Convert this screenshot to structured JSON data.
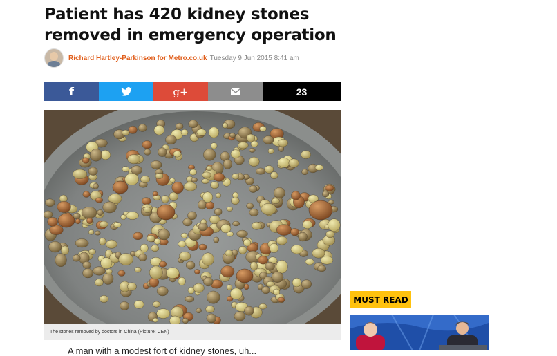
{
  "article": {
    "title": "Patient has 420 kidney stones removed in emergency operation",
    "author": "Richard Hartley-Parkinson for Metro.co.uk",
    "date": "Tuesday 9 Jun 2015 8:41 am"
  },
  "share": {
    "facebook_icon": "f",
    "twitter_icon": "twitter-bird",
    "googleplus_icon": "g+",
    "email_icon": "envelope",
    "count": "23",
    "colors": {
      "facebook": "#3b5998",
      "twitter": "#1da1f2",
      "googleplus": "#dd4b39",
      "email": "#8d8d8d",
      "count": "#000000"
    }
  },
  "photo": {
    "caption": "The stones removed by doctors in China (Picture: CEN)"
  },
  "body": {
    "first_line": "A man with a modest fort of kidney stones, uh..."
  },
  "sidebar": {
    "must_read_label": "MUST READ",
    "must_read_color": "#ffc20e"
  }
}
